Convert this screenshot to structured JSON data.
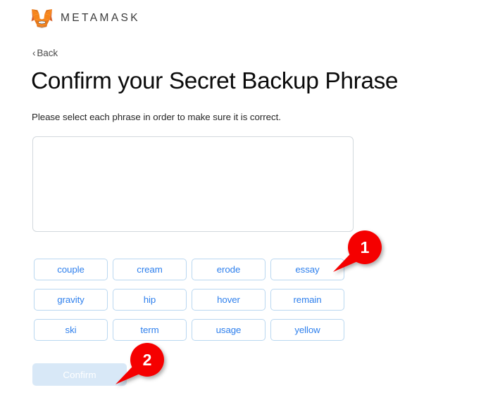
{
  "brand": {
    "name": "METAMASK",
    "logo_icon": "metamask-fox-icon"
  },
  "nav": {
    "back_label": "Back",
    "back_chevron": "‹"
  },
  "page": {
    "title": "Confirm your Secret Backup Phrase",
    "subtitle": "Please select each phrase in order to make sure it is correct."
  },
  "phrase_box": {
    "selected_words": [],
    "value": ""
  },
  "word_chips": [
    {
      "label": "couple"
    },
    {
      "label": "cream"
    },
    {
      "label": "erode"
    },
    {
      "label": "essay"
    },
    {
      "label": "gravity"
    },
    {
      "label": "hip"
    },
    {
      "label": "hover"
    },
    {
      "label": "remain"
    },
    {
      "label": "ski"
    },
    {
      "label": "term"
    },
    {
      "label": "usage"
    },
    {
      "label": "yellow"
    }
  ],
  "confirm_button": {
    "label": "Confirm",
    "disabled": true
  },
  "annotations": [
    {
      "number": "1",
      "target": "essay-chip"
    },
    {
      "number": "2",
      "target": "confirm-button"
    }
  ],
  "colors": {
    "chip_text": "#2f80ed",
    "chip_border": "#b9d7f0",
    "confirm_bg": "#d8e8f7",
    "annotation_red": "#f50000",
    "title_text": "#0b0b0b",
    "brand_text": "#3b3b3b"
  }
}
